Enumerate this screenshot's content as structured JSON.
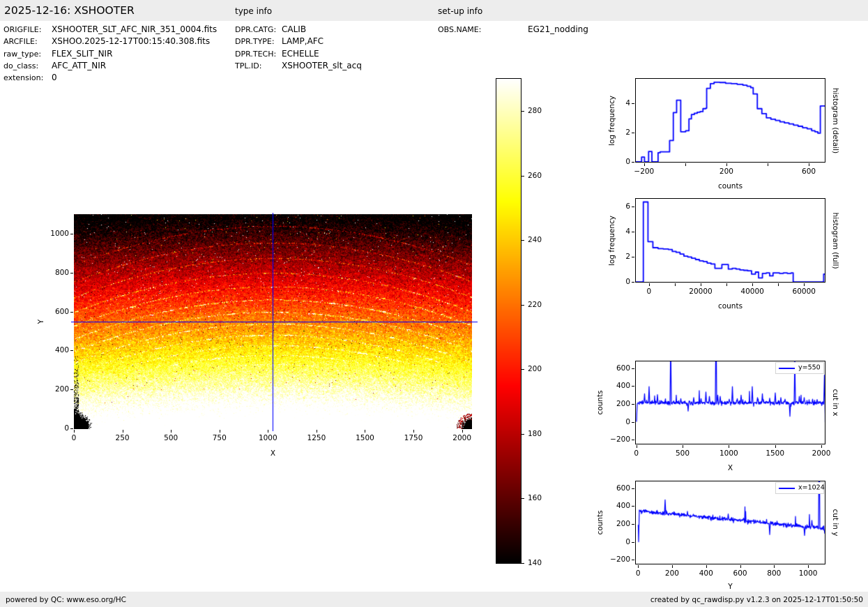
{
  "header": {
    "title": "2025-12-16: XSHOOTER",
    "type_info": "type info",
    "setup_info": "set-up info"
  },
  "meta": {
    "col1": [
      {
        "label": "ORIGFILE:",
        "value": "XSHOOTER_SLT_AFC_NIR_351_0004.fits"
      },
      {
        "label": "ARCFILE:",
        "value": "XSHOO.2025-12-17T00:15:40.308.fits"
      },
      {
        "label": "raw_type:",
        "value": "FLEX_SLIT_NIR"
      },
      {
        "label": "do_class:",
        "value": "AFC_ATT_NIR"
      },
      {
        "label": "extension:",
        "value": "0"
      }
    ],
    "col2": [
      {
        "label": "DPR.CATG:",
        "value": "CALIB"
      },
      {
        "label": "DPR.TYPE:",
        "value": "LAMP,AFC"
      },
      {
        "label": "DPR.TECH:",
        "value": "ECHELLE"
      },
      {
        "label": "TPL.ID:",
        "value": "XSHOOTER_slt_acq"
      }
    ],
    "col3": [
      {
        "label": "OBS.NAME:",
        "value": "EG21_nodding"
      }
    ]
  },
  "footer": {
    "left": "powered by QC: www.eso.org/HC",
    "right": "created by qc_rawdisp.py v1.2.3 on 2025-12-17T01:50:50"
  },
  "colors": {
    "line": "#0000ff",
    "panel_bg": "#ededed",
    "legend_edge": "#d4d4d4"
  },
  "chart_data": [
    {
      "id": "detector-image",
      "type": "heatmap",
      "xlabel": "X",
      "ylabel": "Y",
      "xlim": [
        0,
        2048
      ],
      "ylim": [
        0,
        1100
      ],
      "x_ticks": [
        0,
        250,
        500,
        750,
        1000,
        1250,
        1500,
        1750,
        2000
      ],
      "y_ticks": [
        0,
        200,
        400,
        600,
        800,
        1000
      ],
      "colormap": "hot",
      "vmin": 140,
      "vmax": 290,
      "colorbar_ticks": [
        140,
        160,
        180,
        200,
        220,
        240,
        260,
        280
      ],
      "crosshair": {
        "x": 1024,
        "y": 550
      },
      "background_trend": {
        "a": 319.9,
        "b": 0.1821,
        "c": -1.43e-05
      },
      "noise_sigma": 10,
      "echelle_arc_peaks_y": [
        1040,
        955,
        875,
        800,
        730,
        663,
        600,
        540,
        483,
        430,
        380,
        333
      ],
      "arc_sag": 200,
      "seed": 12345
    },
    {
      "id": "histogram-detail",
      "type": "step-line",
      "xlabel": "counts",
      "ylabel": "log frequency",
      "right_label": "histogram (detail)",
      "xlim": [
        -240,
        681
      ],
      "ylim": [
        -0.05,
        5.65
      ],
      "x_ticks": [
        -200,
        0,
        200,
        400,
        600
      ],
      "x_tick_labels": [
        "−200",
        "",
        "200",
        "",
        "600"
      ],
      "y_ticks": [
        0,
        2,
        4
      ],
      "y_tick_labels": [
        "0",
        "2",
        "4"
      ],
      "points": [
        [
          -240,
          0
        ],
        [
          -212,
          0.32
        ],
        [
          -198,
          0
        ],
        [
          -178,
          0.7
        ],
        [
          -162,
          0
        ],
        [
          -132,
          0.62
        ],
        [
          -122,
          0.68
        ],
        [
          -80,
          0.68
        ],
        [
          -76,
          1.45
        ],
        [
          -58,
          3.35
        ],
        [
          -42,
          4.2
        ],
        [
          -22,
          2.05
        ],
        [
          2,
          2.12
        ],
        [
          18,
          2.92
        ],
        [
          30,
          3.22
        ],
        [
          44,
          3.3
        ],
        [
          58,
          3.38
        ],
        [
          72,
          3.42
        ],
        [
          86,
          3.62
        ],
        [
          100,
          3.65
        ],
        [
          104,
          5.0
        ],
        [
          122,
          5.32
        ],
        [
          140,
          5.42
        ],
        [
          168,
          5.4
        ],
        [
          196,
          5.35
        ],
        [
          224,
          5.32
        ],
        [
          252,
          5.28
        ],
        [
          280,
          5.22
        ],
        [
          300,
          5.15
        ],
        [
          318,
          5.05
        ],
        [
          330,
          4.62
        ],
        [
          350,
          3.62
        ],
        [
          372,
          3.28
        ],
        [
          394,
          3.0
        ],
        [
          416,
          2.9
        ],
        [
          438,
          2.82
        ],
        [
          460,
          2.72
        ],
        [
          482,
          2.65
        ],
        [
          504,
          2.58
        ],
        [
          526,
          2.5
        ],
        [
          548,
          2.42
        ],
        [
          570,
          2.32
        ],
        [
          592,
          2.25
        ],
        [
          614,
          2.12
        ],
        [
          630,
          2.05
        ],
        [
          644,
          1.95
        ],
        [
          656,
          3.8
        ],
        [
          681,
          3.8
        ]
      ]
    },
    {
      "id": "histogram-full",
      "type": "step-line",
      "xlabel": "counts",
      "ylabel": "log frequency",
      "right_label": "histogram (full)",
      "xlim": [
        -5100,
        68300
      ],
      "ylim": [
        -0.05,
        6.6
      ],
      "x_ticks": [
        0,
        10000,
        20000,
        30000,
        40000,
        50000,
        60000
      ],
      "x_tick_labels": [
        "0",
        "",
        "20000",
        "",
        "40000",
        "",
        "60000"
      ],
      "y_ticks": [
        0,
        2,
        4,
        6
      ],
      "y_tick_labels": [
        "0",
        "2",
        "4",
        "6"
      ],
      "points": [
        [
          -5100,
          0
        ],
        [
          -2200,
          6.35
        ],
        [
          -400,
          3.2
        ],
        [
          1500,
          2.72
        ],
        [
          3500,
          2.65
        ],
        [
          5500,
          2.62
        ],
        [
          7500,
          2.58
        ],
        [
          9000,
          2.42
        ],
        [
          10500,
          2.35
        ],
        [
          12000,
          2.22
        ],
        [
          13500,
          2.05
        ],
        [
          15000,
          1.98
        ],
        [
          16500,
          1.88
        ],
        [
          18000,
          1.78
        ],
        [
          19500,
          1.68
        ],
        [
          21000,
          1.62
        ],
        [
          22500,
          1.5
        ],
        [
          24000,
          1.42
        ],
        [
          25500,
          1.08
        ],
        [
          28200,
          1.38
        ],
        [
          30700,
          1.02
        ],
        [
          32200,
          1.08
        ],
        [
          33700,
          1.02
        ],
        [
          35200,
          0.95
        ],
        [
          36700,
          0.92
        ],
        [
          38200,
          0.88
        ],
        [
          39700,
          0.62
        ],
        [
          41200,
          0.78
        ],
        [
          42400,
          0.32
        ],
        [
          43900,
          0.68
        ],
        [
          45400,
          0.72
        ],
        [
          46700,
          0.48
        ],
        [
          48000,
          0.72
        ],
        [
          50500,
          0.68
        ],
        [
          52000,
          0.72
        ],
        [
          53500,
          0.68
        ],
        [
          55000,
          0.72
        ],
        [
          55800,
          0
        ],
        [
          67600,
          0.62
        ],
        [
          68300,
          0.62
        ]
      ]
    },
    {
      "id": "cut-in-x",
      "type": "noisy-line",
      "xlabel": "X",
      "ylabel": "counts",
      "right_label": "cut in x",
      "legend": "y=550",
      "xlim": [
        -5,
        2045
      ],
      "ylim": [
        -254,
        678
      ],
      "x_ticks": [
        0,
        500,
        1000,
        1500,
        2000
      ],
      "x_tick_labels": [
        "0",
        "500",
        "1000",
        "1500",
        "2000"
      ],
      "y_ticks": [
        -200,
        0,
        200,
        400,
        600
      ],
      "y_tick_labels": [
        "−200",
        "0",
        "200",
        "400",
        "600"
      ],
      "domain": [
        0,
        2045
      ],
      "trend_start": 214,
      "trend_end": 214,
      "noise_sigma": 9,
      "spikes": [
        [
          2,
          0
        ],
        [
          90,
          315
        ],
        [
          140,
          395
        ],
        [
          230,
          305
        ],
        [
          370,
          940
        ],
        [
          480,
          260
        ],
        [
          560,
          120
        ],
        [
          622,
          272
        ],
        [
          700,
          260
        ],
        [
          752,
          335
        ],
        [
          792,
          285
        ],
        [
          860,
          1250
        ],
        [
          882,
          300
        ],
        [
          908,
          285
        ],
        [
          1005,
          255
        ],
        [
          1040,
          395
        ],
        [
          1092,
          260
        ],
        [
          1132,
          300
        ],
        [
          1252,
          395
        ],
        [
          1312,
          272
        ],
        [
          1362,
          315
        ],
        [
          1442,
          265
        ],
        [
          1502,
          325
        ],
        [
          1562,
          272
        ],
        [
          1608,
          255
        ],
        [
          1660,
          62
        ],
        [
          1712,
          700
        ],
        [
          1762,
          285
        ],
        [
          1815,
          272
        ],
        [
          1905,
          255
        ],
        [
          1955,
          250
        ],
        [
          2032,
          525
        ],
        [
          2044,
          -5
        ]
      ],
      "seed": 7
    },
    {
      "id": "cut-in-y",
      "type": "noisy-line",
      "xlabel": "Y",
      "ylabel": "counts",
      "right_label": "cut in y",
      "legend": "x=1024",
      "xlim": [
        -13,
        1102
      ],
      "ylim": [
        -254,
        678
      ],
      "x_ticks": [
        0,
        200,
        400,
        600,
        800,
        1000
      ],
      "x_tick_labels": [
        "0",
        "200",
        "400",
        "600",
        "800",
        "1000"
      ],
      "y_ticks": [
        -200,
        0,
        200,
        400,
        600
      ],
      "y_tick_labels": [
        "−200",
        "0",
        "200",
        "400",
        "600"
      ],
      "domain": [
        0,
        1100
      ],
      "trend_start": 348,
      "trend_end": 150,
      "noise_sigma": 9,
      "spikes": [
        [
          3,
          0
        ],
        [
          160,
          472
        ],
        [
          250,
          300
        ],
        [
          340,
          295
        ],
        [
          420,
          285
        ],
        [
          530,
          312
        ],
        [
          620,
          265
        ],
        [
          700,
          240
        ],
        [
          775,
          82
        ],
        [
          900,
          205
        ],
        [
          980,
          72
        ],
        [
          1022,
          240
        ],
        [
          1065,
          1300
        ],
        [
          1098,
          95
        ]
      ],
      "seed": 21
    }
  ]
}
